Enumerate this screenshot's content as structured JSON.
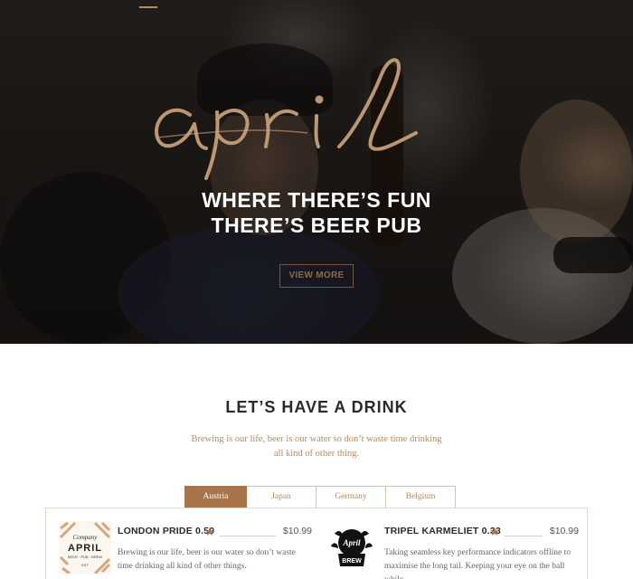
{
  "hero": {
    "script_title": "april",
    "headline_line1": "WHERE THERE’S FUN",
    "headline_line2": "THERE’S BEER PUB",
    "button_label": "VIEW MORE"
  },
  "drinks": {
    "title": "LET’S HAVE A DRINK",
    "description": "Brewing is our life, beer is our water so don’t waste time drinking all kind of other thing.",
    "tabs": [
      {
        "label": "Austria",
        "active": true
      },
      {
        "label": "Japan",
        "active": false
      },
      {
        "label": "Germany",
        "active": false
      },
      {
        "label": "Belgium",
        "active": false
      }
    ],
    "items": [
      {
        "name": "LONDON PRIDE 0.50",
        "price": "$10.99",
        "description": "Brewing is our life, beer is our water so don’t waste time drinking all kind of other things.",
        "logo_text": "APRIL"
      },
      {
        "name": "TRIPEL KARMELIET 0.33",
        "price": "$10.99",
        "description": "Taking seamless key performance indicators offline to maximise the long tail. Keeping your eye on the ball while.",
        "logo_text": "APRIL BREW"
      }
    ]
  },
  "colors": {
    "accent": "#a9744a",
    "accent_light": "#b98a5e",
    "text_dark": "#2a2a2a"
  }
}
